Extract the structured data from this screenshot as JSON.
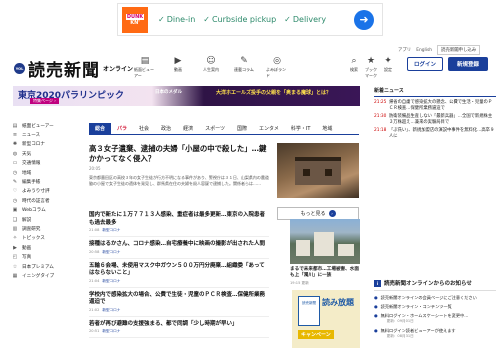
{
  "ad": {
    "brand_top": "DUNK",
    "brand_bottom": "KN'",
    "options": [
      "Dine-in",
      "Curbside pickup",
      "Delivery"
    ],
    "arrow": "➜"
  },
  "utility": {
    "app": "アプリ",
    "english": "English",
    "register": "読売新聞申し込み"
  },
  "logo": {
    "badge": "YOL",
    "title": "読売新聞",
    "subtitle": "オンライン"
  },
  "nav": [
    {
      "icon": "newspaper-icon",
      "glyph": "▤",
      "label": "紙面ビューアー"
    },
    {
      "icon": "video-icon",
      "glyph": "▶",
      "label": "動画"
    },
    {
      "icon": "people-icon",
      "glyph": "☺",
      "label": "人生案内"
    },
    {
      "icon": "book-icon",
      "glyph": "✎",
      "label": "連載コラム"
    },
    {
      "icon": "compass-icon",
      "glyph": "◎",
      "label": "よみぽランド"
    }
  ],
  "right_icons": [
    {
      "icon": "search-icon",
      "glyph": "⌕",
      "label": "検索"
    },
    {
      "icon": "bookmark-icon",
      "glyph": "★",
      "label": "ブックマーク"
    },
    {
      "icon": "settings-icon",
      "glyph": "✦",
      "label": "設定"
    }
  ],
  "buttons": {
    "login": "ログイン",
    "signup": "新規登録"
  },
  "banner": {
    "title": "東京2020パラリンピック",
    "tag": "特集ページ ›",
    "tagline": "日本のメダル",
    "headline": "大洋ホエールズ投手の父親を「奥まる魔球」とは？"
  },
  "news_flash": {
    "heading": "新着ニュース",
    "items": [
      {
        "time": "21:25",
        "text": "帰省の自粛で感染拡大の懸念、公費で生活・児童のＰＣＲ検査…保健所業務逼迫で"
      },
      {
        "time": "21:30",
        "text": "防衛装備品生産しない「最新兵器」…全国で新規株主３万株超え…兼来の実験局目で"
      },
      {
        "time": "21:18",
        "text": "「ぷ氏い」、新規加盟店の演説中事件を無料化…高卒９人に"
      }
    ]
  },
  "sidebar": [
    {
      "icon": "newspaper-icon",
      "glyph": "▤",
      "label": "紙面ビューアー"
    },
    {
      "icon": "news-icon",
      "glyph": "≡",
      "label": "ニュース"
    },
    {
      "icon": "virus-icon",
      "glyph": "✺",
      "label": "新型コロナ"
    },
    {
      "icon": "globe-icon",
      "glyph": "◍",
      "label": "天気"
    },
    {
      "icon": "train-icon",
      "glyph": "▭",
      "label": "交通情報"
    },
    {
      "icon": "clock-icon",
      "glyph": "◷",
      "label": "地域"
    },
    {
      "icon": "edit-icon",
      "glyph": "✎",
      "label": "編集手帳"
    },
    {
      "icon": "heart-icon",
      "glyph": "♡",
      "label": "よみうり寸評"
    },
    {
      "icon": "clock-icon",
      "glyph": "◷",
      "label": "時代の証言者"
    },
    {
      "icon": "tv-icon",
      "glyph": "▣",
      "label": "Webコラム"
    },
    {
      "icon": "book-icon",
      "glyph": "❑",
      "label": "解説"
    },
    {
      "icon": "chart-icon",
      "glyph": "▥",
      "label": "調査研究"
    },
    {
      "icon": "bulb-icon",
      "glyph": "✧",
      "label": "トピックス"
    },
    {
      "icon": "video-icon",
      "glyph": "▶",
      "label": "動画"
    },
    {
      "icon": "camera-icon",
      "glyph": "◰",
      "label": "写真"
    },
    {
      "icon": "star-icon",
      "glyph": "☆",
      "label": "日本プレミアム"
    },
    {
      "icon": "calendar-icon",
      "glyph": "▦",
      "label": "イニングタイブ"
    }
  ],
  "tabs": [
    "総合",
    "パラ",
    "社会",
    "政治",
    "経済",
    "スポーツ",
    "国際",
    "エンタメ",
    "科学・IT",
    "地域"
  ],
  "main_article": {
    "title": "高３女子遺棄、逮捕の夫婦「小屋の中で殺した」…鍵かかってなく侵入？",
    "time": "20:05",
    "body": "東京都墨田区の高校３年の女子生徒が行方不明になる事件があり、警視庁は３１日、山梨県内の農道脇の小屋で女子生徒の遺体を発見し、群馬県在住の夫婦を殺人容疑で逮捕した。関係者らは……"
  },
  "more_button": "もっと見る",
  "list_items": [
    {
      "title": "国内で新たに１万７７１３人感染、重症者は最多更新…東京の入院患者も過去最多",
      "time": "21:08",
      "tag": "新型コロナ"
    },
    {
      "title": "接種はるかさん、コロナ感染…自宅療養中に映画の撮影が出された人間",
      "time": "20:58",
      "tag": "新型コロナ"
    },
    {
      "title": "五輪６会場、未使用マスク中ガウン５００万円分廃棄…組織委「あってはならないこと」",
      "time": "21:04",
      "tag": "新型コロナ"
    },
    {
      "title": "学校内で感染拡大の場合、公費で生徒・児童のＰＣＲ検査…保健所業務逼迫で",
      "time": "21:02",
      "tag": "新型コロナ"
    },
    {
      "title": "若者が再び避難の支援強まる、都で同調「少し時期が早い」",
      "time": "20:51",
      "tag": "新型コロナ"
    }
  ],
  "promo": {
    "caption": "まるで未来都市…工場被害、水面も上「濁川」に一族",
    "time": "19:15 更新",
    "book_label": "読売新聞",
    "read_label": "読み放題",
    "campaign": "キャンペーン"
  },
  "services": {
    "heading": "読売新聞オンラインからのお知らせ",
    "items": [
      {
        "text": "読売新聞オンラインの会員ページにご注意ください",
        "sub": ""
      },
      {
        "text": "読売新聞オンライン・コンテンツ一覧",
        "sub": ""
      },
      {
        "text": "無料ログイン・ホームスケーシートを変更中…",
        "sub": "更新：09月01日"
      },
      {
        "text": "無料ログイン読者ビューアーが使えます",
        "sub": "更新：08月31日"
      }
    ]
  }
}
